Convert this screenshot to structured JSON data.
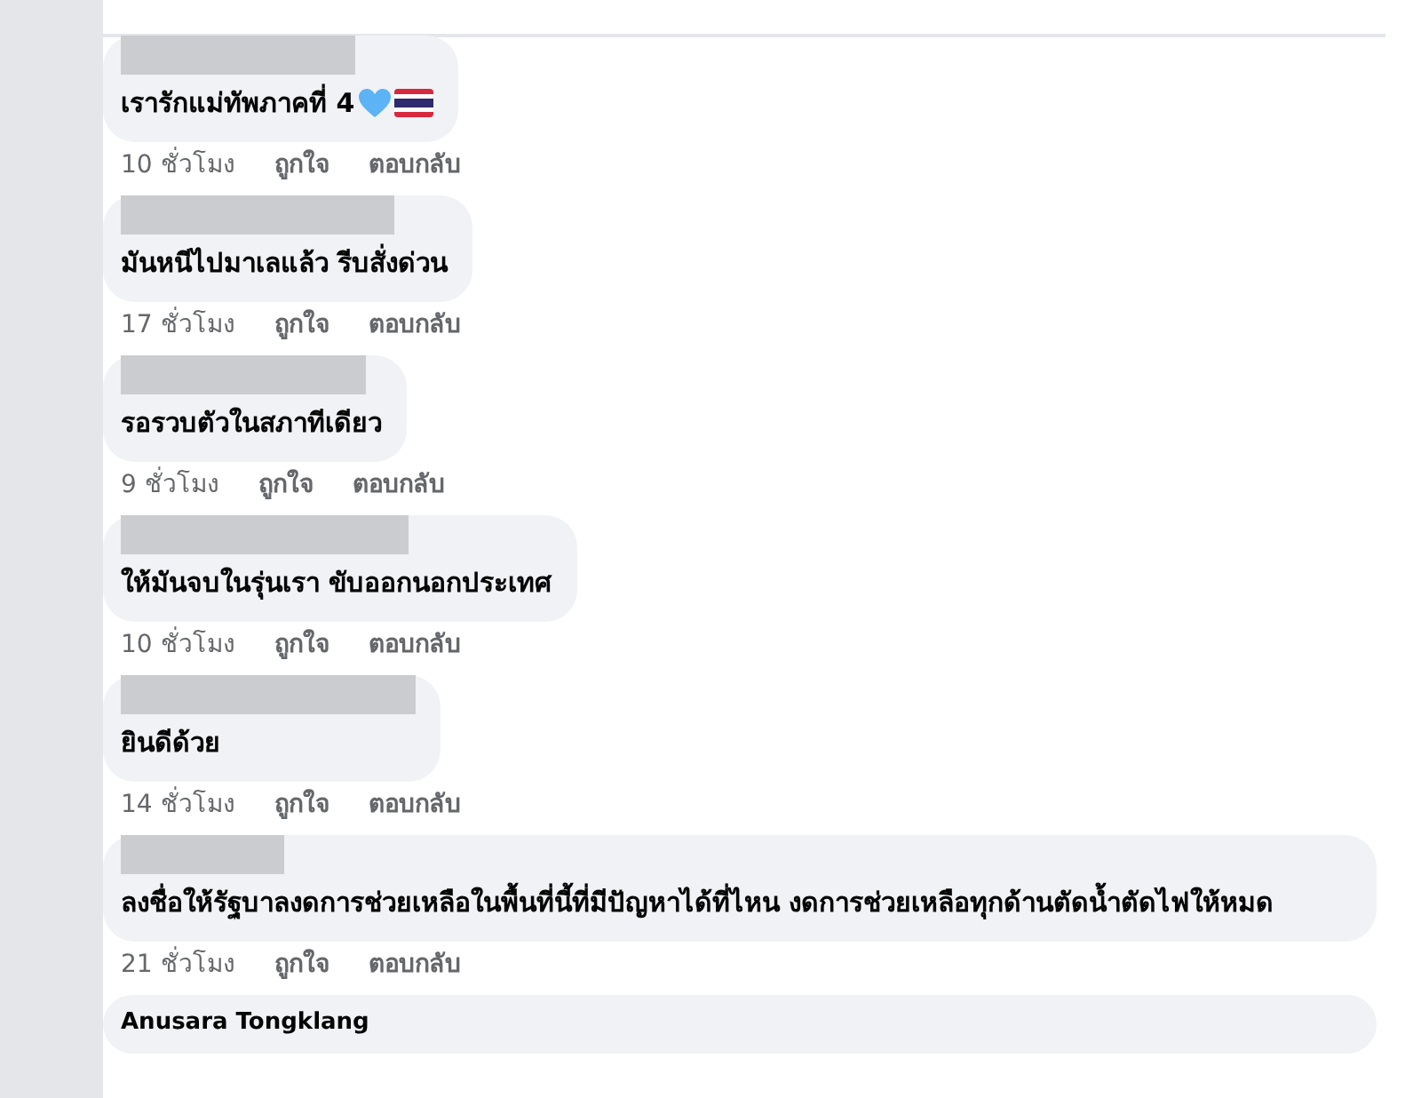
{
  "comments": [
    {
      "name_redacted": true,
      "kind": "emoji",
      "text": "เรารักแม่ทัพภาคที่ 4",
      "time": "10 ชั่วโมง",
      "like": "ถูกใจ",
      "reply": "ตอบกลับ"
    },
    {
      "name_redacted": true,
      "kind": "plain",
      "text": "มันหนีไปมาเลแล้ว รีบสั่งด่วน",
      "time": "17 ชั่วโมง",
      "like": "ถูกใจ",
      "reply": "ตอบกลับ"
    },
    {
      "name_redacted": true,
      "kind": "plain",
      "text": "รอรวบตัวในสภาทีเดียว",
      "time": "9 ชั่วโมง",
      "like": "ถูกใจ",
      "reply": "ตอบกลับ"
    },
    {
      "name_redacted": true,
      "kind": "plain",
      "text": "ให้มันจบในรุ่นเรา ขับออกนอกประเทศ",
      "time": "10 ชั่วโมง",
      "like": "ถูกใจ",
      "reply": "ตอบกลับ"
    },
    {
      "name_redacted": true,
      "kind": "plain",
      "text": "ยินดีด้วย",
      "time": "14 ชั่วโมง",
      "like": "ถูกใจ",
      "reply": "ตอบกลับ"
    },
    {
      "name_redacted": true,
      "kind": "plain",
      "text": "ลงชื่อให้รัฐบาลงดการช่วยเหลือในพื้นที่นี้ที่มีปัญหาได้ที่ไหน งดการช่วยเหลือทุกด้านตัดน้ำตัดไฟให้หมด",
      "time": "21 ชั่วโมง",
      "like": "ถูกใจ",
      "reply": "ตอบกลับ"
    },
    {
      "name_redacted": false,
      "name": "Anusara Tongklang"
    }
  ]
}
